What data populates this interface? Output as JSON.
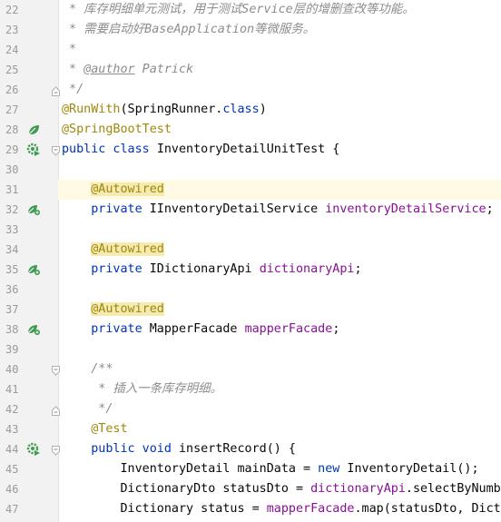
{
  "editor": {
    "lines": [
      {
        "number": "22",
        "segments": [
          {
            "text": " * 库存明细单元测试，用于测试Service层的增删查改等功能。",
            "style": "cmt"
          }
        ]
      },
      {
        "number": "23",
        "segments": [
          {
            "text": " * 需要启动好BaseApplication等微服务。",
            "style": "cmt"
          }
        ]
      },
      {
        "number": "24",
        "segments": [
          {
            "text": " *",
            "style": "cmt"
          }
        ]
      },
      {
        "number": "25",
        "segments": [
          {
            "text": " * ",
            "style": "cmt"
          },
          {
            "text": "@author",
            "style": "cmt-tag"
          },
          {
            "text": " Patrick",
            "style": "cmt"
          }
        ]
      },
      {
        "number": "26",
        "segments": [
          {
            "text": " */",
            "style": "cmt"
          }
        ]
      },
      {
        "number": "27",
        "segments": [
          {
            "text": "@RunWith",
            "style": "ann"
          },
          {
            "text": "(SpringRunner.",
            "style": "plain"
          },
          {
            "text": "class",
            "style": "kw"
          },
          {
            "text": ")",
            "style": "plain"
          }
        ]
      },
      {
        "number": "28",
        "segments": [
          {
            "text": "@SpringBootTest",
            "style": "ann"
          }
        ]
      },
      {
        "number": "29",
        "segments": [
          {
            "text": "public class ",
            "style": "kw"
          },
          {
            "text": "InventoryDetailUnitTest {",
            "style": "plain"
          }
        ]
      },
      {
        "number": "30",
        "segments": []
      },
      {
        "number": "31",
        "segments": [
          {
            "text": "    ",
            "style": "plain"
          },
          {
            "text": "@Autowired",
            "style": "ann annbox"
          }
        ]
      },
      {
        "number": "32",
        "segments": [
          {
            "text": "    private ",
            "style": "kw"
          },
          {
            "text": "IInventoryDetailService ",
            "style": "plain"
          },
          {
            "text": "inventoryDetailService",
            "style": "field"
          },
          {
            "text": ";",
            "style": "plain"
          }
        ]
      },
      {
        "number": "33",
        "segments": []
      },
      {
        "number": "34",
        "segments": [
          {
            "text": "    ",
            "style": "plain"
          },
          {
            "text": "@Autowired",
            "style": "ann annbox"
          }
        ]
      },
      {
        "number": "35",
        "segments": [
          {
            "text": "    private ",
            "style": "kw"
          },
          {
            "text": "IDictionaryApi ",
            "style": "plain"
          },
          {
            "text": "dictionaryApi",
            "style": "field"
          },
          {
            "text": ";",
            "style": "plain"
          }
        ]
      },
      {
        "number": "36",
        "segments": []
      },
      {
        "number": "37",
        "segments": [
          {
            "text": "    ",
            "style": "plain"
          },
          {
            "text": "@Autowired",
            "style": "ann annbox"
          }
        ]
      },
      {
        "number": "38",
        "segments": [
          {
            "text": "    private ",
            "style": "kw"
          },
          {
            "text": "MapperFacade ",
            "style": "plain"
          },
          {
            "text": "mapperFacade",
            "style": "field"
          },
          {
            "text": ";",
            "style": "plain"
          }
        ]
      },
      {
        "number": "39",
        "segments": []
      },
      {
        "number": "40",
        "segments": [
          {
            "text": "    /**",
            "style": "cmt"
          }
        ]
      },
      {
        "number": "41",
        "segments": [
          {
            "text": "     * 插入一条库存明细。",
            "style": "cmt"
          }
        ]
      },
      {
        "number": "42",
        "segments": [
          {
            "text": "     */",
            "style": "cmt"
          }
        ]
      },
      {
        "number": "43",
        "segments": [
          {
            "text": "    ",
            "style": "plain"
          },
          {
            "text": "@Test",
            "style": "ann"
          }
        ]
      },
      {
        "number": "44",
        "segments": [
          {
            "text": "    public void ",
            "style": "kw"
          },
          {
            "text": "insertRecord",
            "style": "plain"
          },
          {
            "text": "() {",
            "style": "plain"
          }
        ]
      },
      {
        "number": "45",
        "segments": [
          {
            "text": "        InventoryDetail mainData = ",
            "style": "plain"
          },
          {
            "text": "new ",
            "style": "kw"
          },
          {
            "text": "InventoryDetail();",
            "style": "plain"
          }
        ]
      },
      {
        "number": "46",
        "segments": [
          {
            "text": "        DictionaryDto statusDto = ",
            "style": "plain"
          },
          {
            "text": "dictionaryApi",
            "style": "field"
          },
          {
            "text": ".selectByNumbe",
            "style": "plain"
          }
        ]
      },
      {
        "number": "47",
        "segments": [
          {
            "text": "        Dictionary status = ",
            "style": "plain"
          },
          {
            "text": "mapperFacade",
            "style": "field"
          },
          {
            "text": ".map(statusDto, Dicti",
            "style": "plain"
          }
        ]
      }
    ],
    "highlighted_line": "31",
    "gutter_icons": {
      "28": "spring-bean-leaf-icon",
      "29": "spring-run-gear-icon",
      "32": "spring-autowired-bean-icon",
      "35": "spring-autowired-bean-icon",
      "38": "spring-autowired-bean-icon",
      "44": "spring-run-gear-icon"
    },
    "fold_markers": {
      "26": "fold-end",
      "29": "fold-start",
      "40": "fold-start",
      "42": "fold-end",
      "44": "fold-start"
    },
    "colors": {
      "keyword": "#0033b3",
      "annotation": "#9e880d",
      "field": "#871094",
      "comment": "#8c8c8c",
      "current_line_bg": "#fffae3",
      "gutter_bg": "#f2f2f2",
      "spring_icon": "#3f9b4f"
    }
  }
}
